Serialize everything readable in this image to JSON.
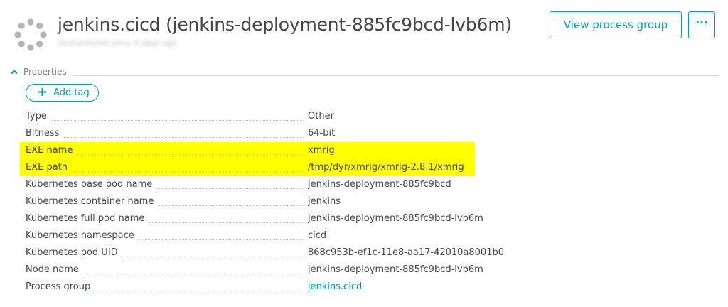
{
  "header": {
    "title": "jenkins.cicd (jenkins-deployment-885fc9bcd-lvb6m)",
    "subtitle": "Unmonitored since 4 days ago",
    "logo_icon": "process-ring-icon",
    "view_button": "View process group",
    "more_button": "···"
  },
  "properties": {
    "section_label": "Properties",
    "add_tag_label": "Add tag",
    "rows": [
      {
        "key": "Type",
        "value": "Other",
        "highlighted": false,
        "link": false
      },
      {
        "key": "Bitness",
        "value": "64-bit",
        "highlighted": false,
        "link": false
      },
      {
        "key": "EXE name",
        "value": "xmrig",
        "highlighted": true,
        "link": false
      },
      {
        "key": "EXE path",
        "value": "/tmp/dyr/xmrig/xmrig-2.8.1/xmrig",
        "highlighted": true,
        "link": false
      },
      {
        "key": "Kubernetes base pod name",
        "value": "jenkins-deployment-885fc9bcd",
        "highlighted": false,
        "link": false
      },
      {
        "key": "Kubernetes container name",
        "value": "jenkins",
        "highlighted": false,
        "link": false
      },
      {
        "key": "Kubernetes full pod name",
        "value": "jenkins-deployment-885fc9bcd-lvb6m",
        "highlighted": false,
        "link": false
      },
      {
        "key": "Kubernetes namespace",
        "value": "cicd",
        "highlighted": false,
        "link": false
      },
      {
        "key": "Kubernetes pod UID",
        "value": "868c953b-ef1c-11e8-aa17-42010a8001b0",
        "highlighted": false,
        "link": false
      },
      {
        "key": "Node name",
        "value": "jenkins-deployment-885fc9bcd-lvb6m",
        "highlighted": false,
        "link": false
      },
      {
        "key": "Process group",
        "value": "jenkins.cicd",
        "highlighted": false,
        "link": true
      }
    ]
  },
  "colors": {
    "accent": "#00a1b2",
    "highlight": "#ffff00",
    "text": "#454646",
    "muted": "#7c7c7c",
    "logo": "#b4b4b4"
  }
}
